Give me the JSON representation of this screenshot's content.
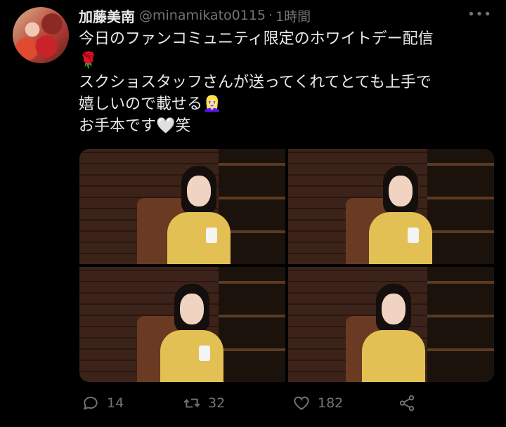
{
  "tweet": {
    "author_name": "加藤美南",
    "handle": "@minamikato0115",
    "separator": "·",
    "time": "1時間",
    "lines": [
      "今日のファンコミュニティ限定のホワイトデー配信",
      "🌹",
      "スクショスタッフさんが送ってくれてとても上手で",
      "嬉しいので載せる👱🏻‍♀️",
      "お手本です🤍笑"
    ]
  },
  "media": {
    "tiles": [
      {
        "pose": "looking-forward-phone"
      },
      {
        "pose": "looking-down-phone"
      },
      {
        "pose": "smiling-phone"
      },
      {
        "pose": "hands-together"
      }
    ]
  },
  "actions": {
    "reply_count": "14",
    "retweet_count": "32",
    "like_count": "182"
  },
  "icons": {
    "reply": "reply-icon",
    "retweet": "retweet-icon",
    "like": "heart-icon",
    "share": "share-icon",
    "more": "more-icon"
  },
  "colors": {
    "background": "#000000",
    "text": "#e7e9ea",
    "muted": "#71767b"
  }
}
